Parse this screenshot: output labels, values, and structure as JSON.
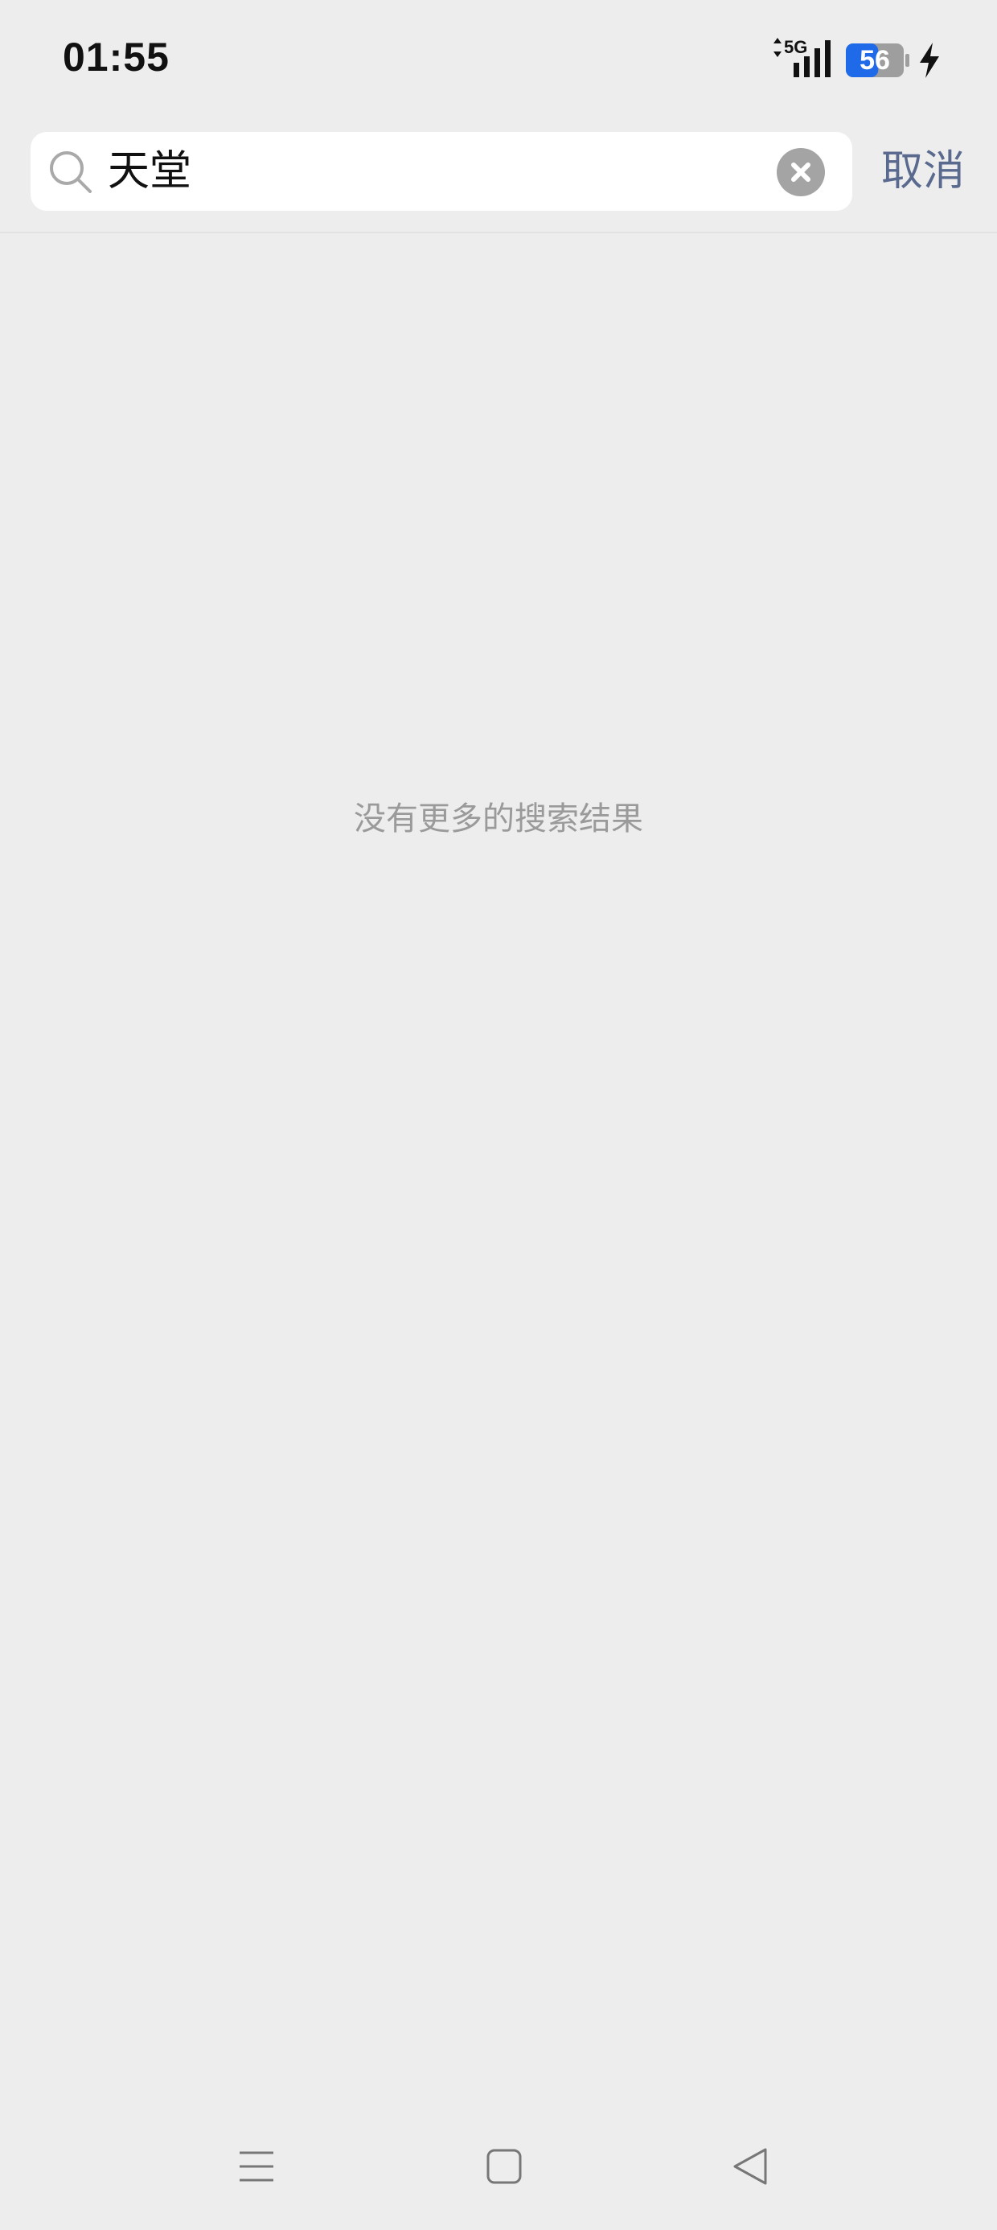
{
  "status_bar": {
    "time": "01:55",
    "network": "5G",
    "battery_level": "56",
    "battery_percent": 56,
    "charging": true,
    "icons": [
      "network-arrows-icon",
      "signal-icon",
      "battery-icon",
      "charging-bolt-icon"
    ]
  },
  "search": {
    "query": "天堂",
    "icon": "search-icon",
    "clear_icon": "clear-icon",
    "cancel_label": "取消"
  },
  "results": {
    "empty_message": "没有更多的搜索结果"
  },
  "nav_bar": {
    "icons": [
      "menu-icon",
      "home-icon",
      "back-icon"
    ]
  },
  "colors": {
    "background": "#ededed",
    "cancel_text": "#5a6a8f",
    "battery_fill": "#1f6ae8",
    "empty_text": "#9a9a9a"
  }
}
